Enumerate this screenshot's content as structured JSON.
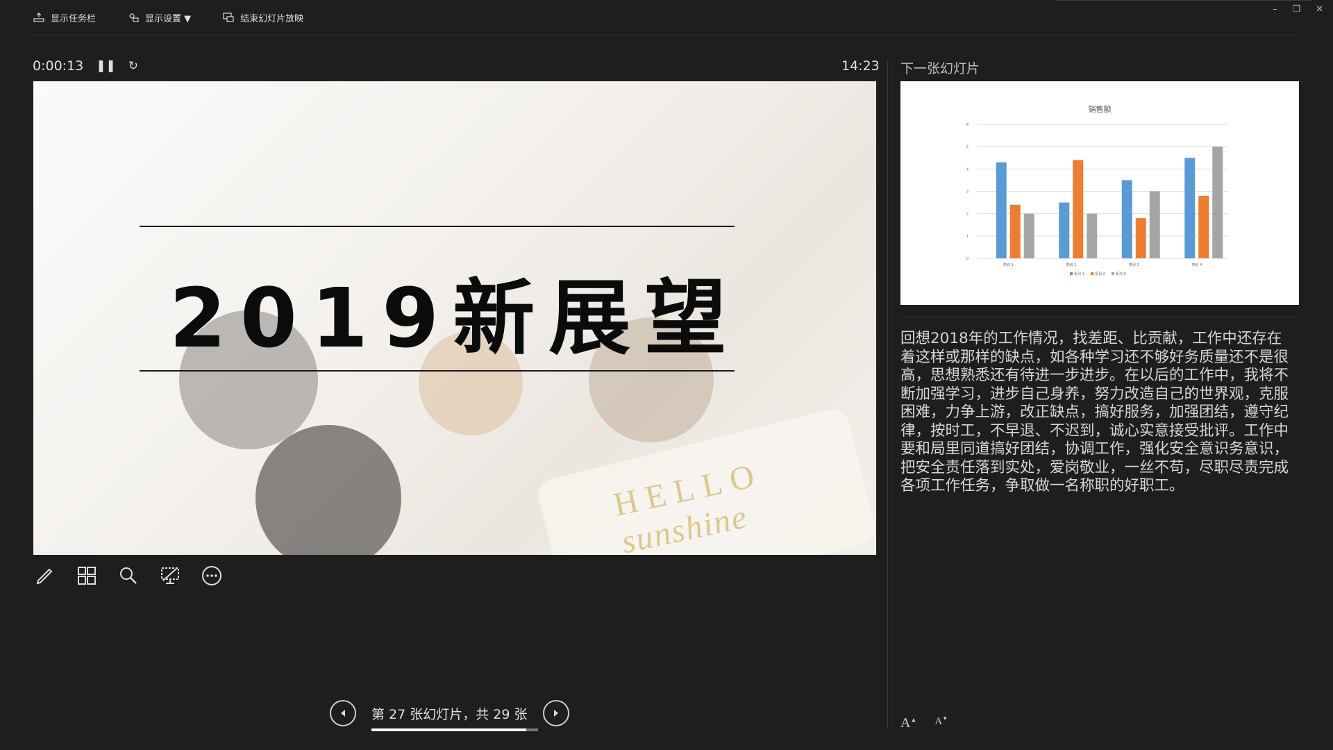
{
  "toolbar": {
    "show_taskbar": "显示任务栏",
    "display_settings": "显示设置 ▼",
    "end_show": "结束幻灯片放映"
  },
  "window": {
    "minimize": "–",
    "restore": "❐",
    "close": "✕"
  },
  "timer": {
    "elapsed": "0:00:13",
    "pause_icon": "pause-icon",
    "restart_icon": "restart-icon"
  },
  "clock": "14:23",
  "current_slide": {
    "title": "2019新展望",
    "image_text_1": "HELLO",
    "image_text_2": "sunshine"
  },
  "tools": [
    "pen-icon",
    "grid-icon",
    "magnifier-icon",
    "screen-icon",
    "more-icon"
  ],
  "navigation": {
    "counter": "第 27 张幻灯片，共 29 张",
    "current": 27,
    "total": 29
  },
  "next_slide_label": "下一张幻灯片",
  "notes": "回想2018年的工作情况，找差距、比贡献，工作中还存在着这样或那样的缺点，如各种学习还不够好务质量还不是很高，思想熟悉还有待进一步进步。在以后的工作中，我将不断加强学习，进步自己身养，努力改造自己的世界观，克服困难，力争上游，改正缺点，搞好服务，加强团结，遵守纪律，按时工，不早退、不迟到，诚心实意接受批评。工作中要和局里同道搞好团结，协调工作，强化安全意识务意识，把安全责任落到实处，爱岗敬业，一丝不苟，尽职尽责完成各项工作任务，争取做一名称职的好职工。",
  "font_controls": {
    "increase": "A",
    "decrease": "A"
  },
  "chart_data": {
    "type": "bar",
    "title": "销售额",
    "categories": [
      "类别 1",
      "类别 2",
      "类别 3",
      "类别 4"
    ],
    "series": [
      {
        "name": "系列 1",
        "values": [
          4.3,
          2.5,
          3.5,
          4.5
        ],
        "color": "#5b9bd5"
      },
      {
        "name": "系列 2",
        "values": [
          2.4,
          4.4,
          1.8,
          2.8
        ],
        "color": "#ed7d31"
      },
      {
        "name": "系列 3",
        "values": [
          2.0,
          2.0,
          3.0,
          5.0
        ],
        "color": "#a5a5a5"
      }
    ],
    "ylim": [
      0,
      6
    ],
    "yticks": [
      "0",
      "1",
      "2",
      "3",
      "4",
      "5",
      "6"
    ],
    "grid": true,
    "legend": "bottom"
  }
}
